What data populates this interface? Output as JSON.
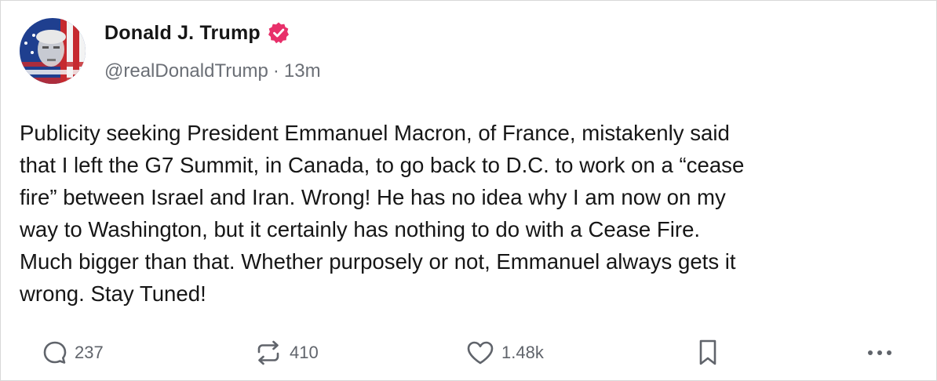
{
  "author": {
    "display_name": "Donald J. Trump",
    "verified": true,
    "handle": "@realDonaldTrump",
    "separator": "·",
    "time": "13m"
  },
  "post": {
    "text": "Publicity seeking President Emmanuel Macron, of France, mistakenly said\nthat I left the G7 Summit, in Canada, to go back to D.C. to work on a “cease\nfire” between Israel and Iran. Wrong! He has no idea why I am now on my\nway to Washington, but it certainly has nothing to do with a Cease Fire.\nMuch bigger than that. Whether purposely or not, Emmanuel always gets it\nwrong. Stay Tuned!"
  },
  "actions": {
    "replies": "237",
    "reposts": "410",
    "likes": "1.48k"
  },
  "icons": {
    "verified": "verified-badge-icon",
    "reply": "reply-icon",
    "repost": "repost-icon",
    "like": "heart-icon",
    "save": "bookmark-icon",
    "more": "more-icon"
  },
  "colors": {
    "verified_badge": "#e8306a",
    "text_primary": "#161616",
    "text_secondary": "#6b6f76"
  }
}
